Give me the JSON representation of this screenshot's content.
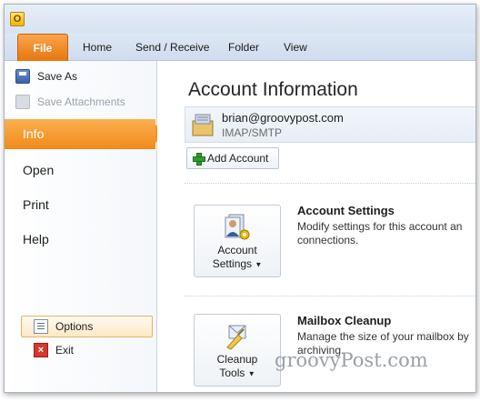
{
  "app": {
    "icon_glyph": "O"
  },
  "ribbon": {
    "file_tab": "File",
    "tabs": [
      "Home",
      "Send / Receive",
      "Folder",
      "View"
    ]
  },
  "backstage": {
    "commands": [
      {
        "label": "Save As",
        "icon": "save-as-icon",
        "enabled": true
      },
      {
        "label": "Save Attachments",
        "icon": "save-attachments-icon",
        "enabled": false
      }
    ],
    "nav": [
      "Info",
      "Open",
      "Print",
      "Help"
    ],
    "selected": "Info",
    "options_label": "Options",
    "exit_label": "Exit"
  },
  "content": {
    "title": "Account Information",
    "account": {
      "email": "brian@groovypost.com",
      "type": "IMAP/SMTP"
    },
    "add_account_label": "Add Account",
    "account_settings": {
      "button_line1": "Account",
      "button_line2": "Settings",
      "title": "Account Settings",
      "desc_line1": "Modify settings for this account an",
      "desc_line2": "connections."
    },
    "mailbox_cleanup": {
      "button_line1": "Cleanup",
      "button_line2": "Tools",
      "title": "Mailbox Cleanup",
      "desc_line1": "Manage the size of your mailbox by",
      "desc_line2": "archiving."
    }
  },
  "watermark": "groovyPost.com",
  "colors": {
    "accent": "#f08a1a",
    "ribbon": "#d7e3f2"
  }
}
